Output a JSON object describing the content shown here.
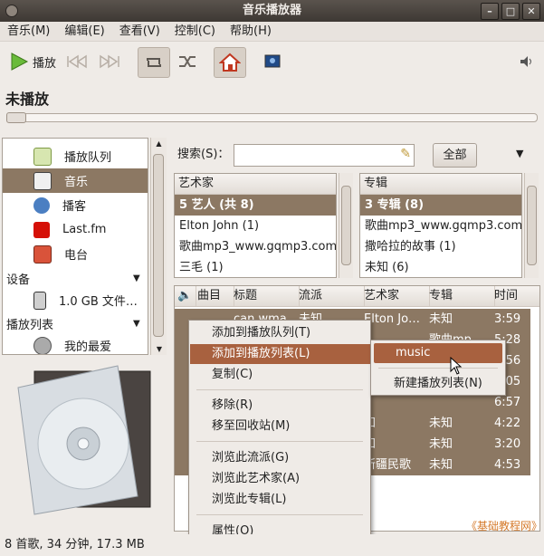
{
  "window": {
    "title": "音乐播放器"
  },
  "menubar": [
    "音乐(M)",
    "编辑(E)",
    "查看(V)",
    "控制(C)",
    "帮助(H)"
  ],
  "toolbar": {
    "play_label": "播放"
  },
  "now_playing": {
    "title": "未播放"
  },
  "sidebar": {
    "library": [
      "播放队列",
      "音乐",
      "播客",
      "Last.fm",
      "电台"
    ],
    "devices_header": "设备",
    "device_item": "1.0 GB 文件…",
    "playlists_header": "播放列表",
    "playlist_item": "我的最爱"
  },
  "search": {
    "label": "搜索(S)：",
    "value": "",
    "all_button": "全部"
  },
  "browser": {
    "artist_header": "艺术家",
    "artists": [
      "5 艺人 (共 8)",
      "Elton John (1)",
      "歌曲mp3_www.gqmp3.com (1)",
      "三毛 (1)"
    ],
    "album_header": "专辑",
    "albums": [
      "3 专辑 (8)",
      "歌曲mp3_www.gqmp3.com (1)",
      "撒哈拉的故事 (1)",
      "未知 (6)"
    ]
  },
  "track_headers": [
    "曲目",
    "标题",
    "流派",
    "艺术家",
    "专辑",
    "时间"
  ],
  "tracks": [
    {
      "title": "can wma",
      "genre": "未知",
      "artist": "Elton Jo…",
      "album": "未知",
      "time": "3:59"
    },
    {
      "title": "",
      "genre": "",
      "artist": "",
      "album": "歌曲mp…",
      "time": "5:28"
    },
    {
      "title": "",
      "genre": "",
      "artist": "",
      "album": "",
      "time": "4:56"
    },
    {
      "title": "",
      "genre": "",
      "artist": "",
      "album": "",
      "time": "3:05"
    },
    {
      "title": "",
      "genre": "",
      "artist": "",
      "album": "",
      "time": "6:57"
    },
    {
      "title": "",
      "genre": "",
      "artist": "知",
      "album": "未知",
      "time": "4:22"
    },
    {
      "title": "",
      "genre": "",
      "artist": "知",
      "album": "未知",
      "time": "3:20"
    },
    {
      "title": "",
      "genre": "",
      "artist": "新疆民歌",
      "album": "未知",
      "time": "4:53"
    }
  ],
  "context_menu": [
    "添加到播放队列(T)",
    "添加到播放列表(L)",
    "复制(C)",
    "移除(R)",
    "移至回收站(M)",
    "浏览此流派(G)",
    "浏览此艺术家(A)",
    "浏览此专辑(L)",
    "属性(O)"
  ],
  "submenu": {
    "playlist": "music",
    "new_playlist": "新建播放列表(N)"
  },
  "status": "8 首歌, 34 分钟, 17.3 MB",
  "watermark": "《基础教程网》",
  "colors": {
    "selection": "#8c7863",
    "highlight": "#a8613f",
    "titlebar": "#3d3833"
  }
}
